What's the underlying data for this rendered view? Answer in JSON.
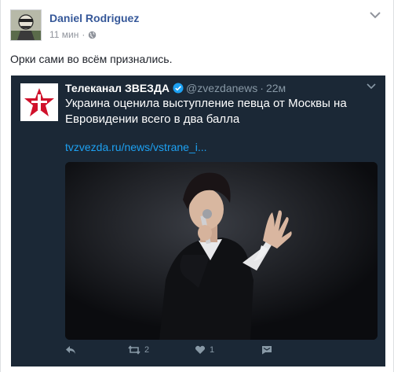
{
  "post": {
    "author": "Daniel Rodriguez",
    "time": "11 мин",
    "separator": "·",
    "text": "Орки сами во всём признались."
  },
  "tweet": {
    "account_name": "Телеканал ЗВЕЗДА",
    "handle": "@zvezdanews",
    "dot": "·",
    "time": "22м",
    "text": "Украина оценила выступление певца от Москвы на Евровидении всего в два балла",
    "link": "tvzvezda.ru/news/vstrane_i...",
    "retweets": "2",
    "likes": "1",
    "colors": {
      "background": "#1b2836",
      "link": "#1da1f2",
      "muted": "#8899a6",
      "verified": "#1da1f2",
      "logo_star": "#d0112b"
    }
  },
  "icons": {
    "avatar": "avatar-image",
    "globe": "globe-icon",
    "post_menu": "chevron-down-icon",
    "tweet_logo": "star-logo",
    "verified": "verified-badge-icon",
    "tweet_menu": "chevron-down-icon",
    "reply": "reply-icon",
    "retweet": "retweet-icon",
    "like": "heart-icon",
    "dm": "direct-message-icon"
  }
}
